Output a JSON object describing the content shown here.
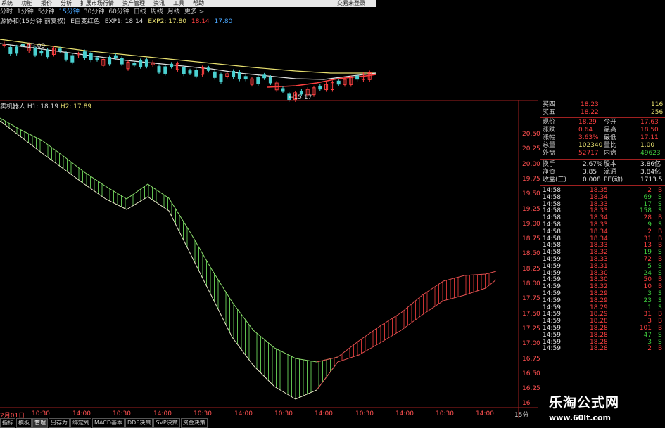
{
  "menu": {
    "items": [
      "系统",
      "功能",
      "报价",
      "分析",
      "扩展市场行情",
      "资产管理",
      "资讯",
      "工具",
      "帮助"
    ],
    "app_title": "交易未登录"
  },
  "periods": {
    "items": [
      "分时",
      "1分钟",
      "5分钟",
      "15分钟",
      "30分钟",
      "60分钟",
      "日线",
      "周线",
      "月线",
      "更多 >"
    ],
    "active_index": 3
  },
  "indicator": {
    "name": "源协和(15分钟 前复权)",
    "mode": "E自变红色",
    "exp1": "EXP1: 18.14",
    "exp2": "EXP2: 17.80",
    "v3": "18.14",
    "v4": "17.80"
  },
  "upper_labels": {
    "high": "19.09",
    "low": "15.17"
  },
  "robot": {
    "title": "卖机器人",
    "h1": "H1: 18.19",
    "h2": "H2: 17.89"
  },
  "price_axis": [
    "20.50",
    "20.25",
    "20.00",
    "19.75",
    "19.50",
    "19.25",
    "19.00",
    "18.75",
    "18.50",
    "18.25",
    "18.00",
    "17.75",
    "17.50",
    "17.25",
    "17.00",
    "16.75",
    "16.50",
    "16.25",
    "16"
  ],
  "time_axis": [
    "2月01日",
    "10:30",
    "14:00",
    "10:30",
    "14:00",
    "10:30",
    "14:00",
    "10:30",
    "14:00",
    "10:30",
    "14:00",
    "10:30",
    "14:00"
  ],
  "period_label": "15分",
  "bottom_tabs": [
    "指标",
    "模板",
    "管理",
    "另存为",
    "绑定到",
    "MACD基本",
    "DDE决策",
    "SVP决策",
    "资金决策"
  ],
  "bottom_tabs_active": 2,
  "quote": {
    "ask4": {
      "label": "买四",
      "price": "18.23",
      "vol": "116"
    },
    "ask5": {
      "label": "买五",
      "price": "18.22",
      "vol": "256"
    },
    "rows": [
      {
        "l1": "现价",
        "v1": "18.29",
        "l2": "今开",
        "v2": "17.63"
      },
      {
        "l1": "涨跌",
        "v1": "0.64",
        "l2": "最高",
        "v2": "18.50"
      },
      {
        "l1": "涨幅",
        "v1": "3.63%",
        "l2": "最低",
        "v2": "17.11"
      },
      {
        "l1": "总量",
        "v1": "102340",
        "l2": "量比",
        "v2": "1.00"
      },
      {
        "l1": "外盘",
        "v1": "52717",
        "l2": "内盘",
        "v2": "49623"
      }
    ],
    "rows2": [
      {
        "l1": "换手",
        "v1": "2.67%",
        "l2": "股本",
        "v2": "3.86亿"
      },
      {
        "l1": "净资",
        "v1": "3.85",
        "l2": "流通",
        "v2": "3.84亿"
      },
      {
        "l1": "收益(三)",
        "v1": "0.008",
        "l2": "PE(动)",
        "v2": "1713.5"
      }
    ]
  },
  "ticks": [
    {
      "t": "14:58",
      "p": "18.35",
      "v": "2",
      "s": "B"
    },
    {
      "t": "14:58",
      "p": "18.34",
      "v": "69",
      "s": "S"
    },
    {
      "t": "14:58",
      "p": "18.33",
      "v": "17",
      "s": "S"
    },
    {
      "t": "14:58",
      "p": "18.33",
      "v": "158",
      "s": "S"
    },
    {
      "t": "14:58",
      "p": "18.34",
      "v": "28",
      "s": "B"
    },
    {
      "t": "14:58",
      "p": "18.33",
      "v": "9",
      "s": "S"
    },
    {
      "t": "14:58",
      "p": "18.34",
      "v": "2",
      "s": "B"
    },
    {
      "t": "14:58",
      "p": "18.34",
      "v": "31",
      "s": "B"
    },
    {
      "t": "14:58",
      "p": "18.33",
      "v": "13",
      "s": "B"
    },
    {
      "t": "14:58",
      "p": "18.32",
      "v": "19",
      "s": "S"
    },
    {
      "t": "14:59",
      "p": "18.33",
      "v": "72",
      "s": "B"
    },
    {
      "t": "14:59",
      "p": "18.31",
      "v": "5",
      "s": "S"
    },
    {
      "t": "14:59",
      "p": "18.30",
      "v": "24",
      "s": "S"
    },
    {
      "t": "14:59",
      "p": "18.30",
      "v": "50",
      "s": "B"
    },
    {
      "t": "14:59",
      "p": "18.32",
      "v": "10",
      "s": "B"
    },
    {
      "t": "14:59",
      "p": "18.29",
      "v": "3",
      "s": "S"
    },
    {
      "t": "14:59",
      "p": "18.29",
      "v": "23",
      "s": "S"
    },
    {
      "t": "14:59",
      "p": "18.29",
      "v": "1",
      "s": "S"
    },
    {
      "t": "14:59",
      "p": "18.29",
      "v": "31",
      "s": "B"
    },
    {
      "t": "14:59",
      "p": "18.28",
      "v": "3",
      "s": "B"
    },
    {
      "t": "14:59",
      "p": "18.28",
      "v": "101",
      "s": "B"
    },
    {
      "t": "14:59",
      "p": "18.28",
      "v": "47",
      "s": "S"
    },
    {
      "t": "14:59",
      "p": "18.28",
      "v": "3",
      "s": "S"
    },
    {
      "t": "14:59",
      "p": "18.28",
      "v": "2",
      "s": "B"
    }
  ],
  "watermark": {
    "title": "乐淘公式网",
    "url": "www.60lt.com"
  },
  "colors": {
    "up": "#ff4040",
    "down": "#4ad0d0",
    "green_band": "#5fbf4f",
    "red_band": "#c83232",
    "axis": "#a02020"
  }
}
